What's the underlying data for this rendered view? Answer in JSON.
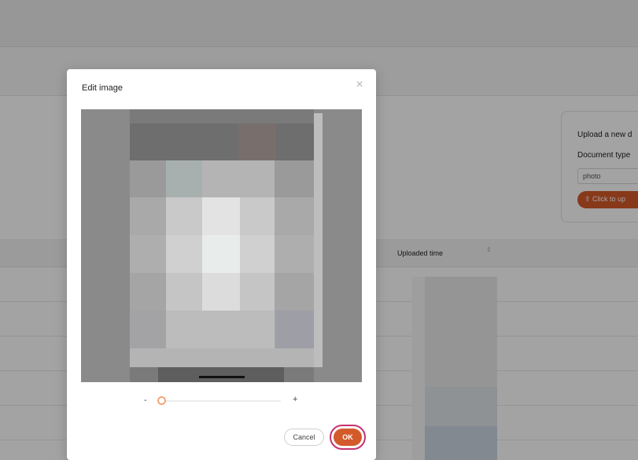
{
  "upload_panel": {
    "title": "Upload a new d",
    "doc_type_label": "Document type",
    "doc_type_value": "photo",
    "upload_button": "⇪ Click to up",
    "accent_color": "#d35a2a"
  },
  "table": {
    "columns": [
      "Uploaded time"
    ],
    "sort_icon": "⇕"
  },
  "modal": {
    "title": "Edit image",
    "close_icon": "×",
    "zoom": {
      "minus_label": "-",
      "plus_label": "+",
      "level": 0
    },
    "buttons": {
      "cancel": "Cancel",
      "ok": "OK"
    },
    "accent_color": "#d35a2a"
  }
}
